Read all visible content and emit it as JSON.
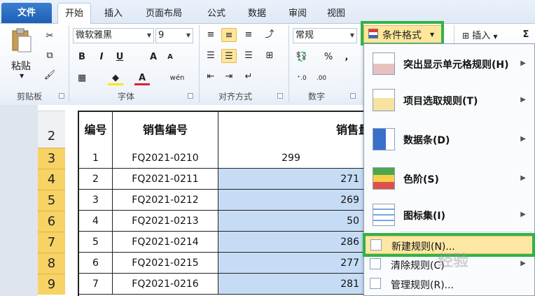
{
  "tabs": [
    {
      "label": "文件"
    },
    {
      "label": "开始"
    },
    {
      "label": "插入"
    },
    {
      "label": "页面布局"
    },
    {
      "label": "公式"
    },
    {
      "label": "数据"
    },
    {
      "label": "审阅"
    },
    {
      "label": "视图"
    }
  ],
  "ribbon": {
    "paste_label": "粘贴",
    "clipboard_label": "剪贴板",
    "font_name": "微软雅黑",
    "font_size": "9",
    "font_label": "字体",
    "align_label": "对齐方式",
    "number_format": "常规",
    "number_label": "数字",
    "cond_format_label": "条件格式",
    "insert_label": "插入",
    "sigma": "Σ",
    "bold": "B",
    "italic": "I",
    "underline": "U",
    "grow_font": "A",
    "font_color": "A",
    "wen": "wén",
    "percent": "%",
    "comma": ",",
    "dec_inc": "⁺.0",
    "dec_dec": ".00"
  },
  "sheet": {
    "header_row_number": "2",
    "col_headers": [
      "编号",
      "销售编号",
      "销售量"
    ],
    "rows": [
      {
        "rownum": "3",
        "id": "1",
        "code": "FQ2021-0210",
        "sales": "299"
      },
      {
        "rownum": "4",
        "id": "2",
        "code": "FQ2021-0211",
        "sales": "271"
      },
      {
        "rownum": "5",
        "id": "3",
        "code": "FQ2021-0212",
        "sales": "269"
      },
      {
        "rownum": "6",
        "id": "4",
        "code": "FQ2021-0213",
        "sales": "50"
      },
      {
        "rownum": "7",
        "id": "5",
        "code": "FQ2021-0214",
        "sales": "286"
      },
      {
        "rownum": "8",
        "id": "6",
        "code": "FQ2021-0215",
        "sales": "277"
      },
      {
        "rownum": "9",
        "id": "7",
        "code": "FQ2021-0216",
        "sales": "281"
      }
    ]
  },
  "menu": {
    "items": [
      {
        "label": "突出显示单元格规则(H)",
        "icon": "highlight-rules-icon"
      },
      {
        "label": "项目选取规则(T)",
        "icon": "top-bottom-rules-icon"
      },
      {
        "label": "数据条(D)",
        "icon": "data-bars-icon"
      },
      {
        "label": "色阶(S)",
        "icon": "color-scales-icon"
      },
      {
        "label": "图标集(I)",
        "icon": "icon-sets-icon"
      }
    ],
    "new_rule": "新建规则(N)...",
    "clear_rules": "清除规则(C)",
    "manage_rules": "管理规则(R)..."
  },
  "watermark": "经验",
  "colors": {
    "highlight_green": "#2fb34b",
    "row_header_yellow": "#f7d265",
    "sales_blue": "#c6dcf5",
    "menu_select": "#fde7a5"
  }
}
